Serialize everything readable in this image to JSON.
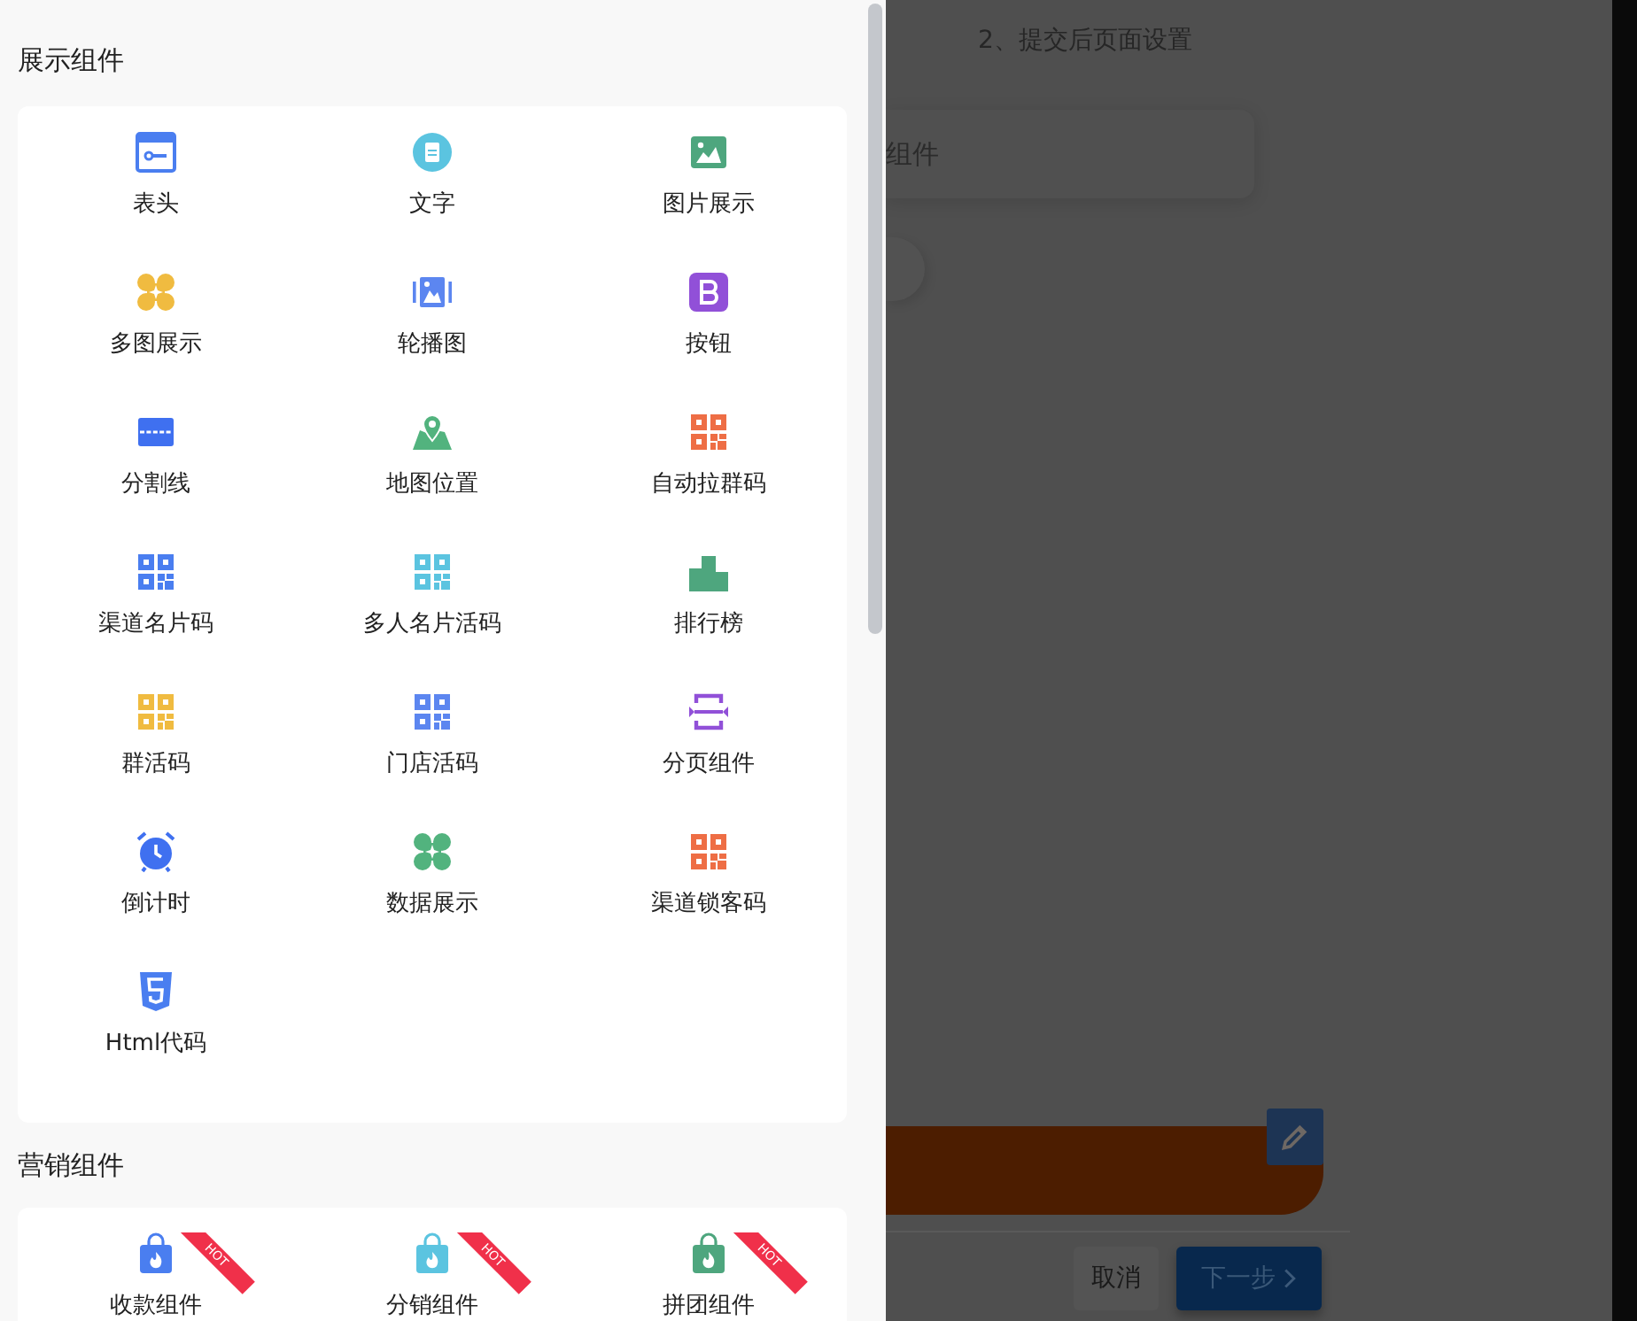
{
  "sections": [
    {
      "title": "展示组件",
      "items": [
        {
          "label": "表头",
          "kind": "header",
          "color": "#4a7ef0"
        },
        {
          "label": "文字",
          "kind": "text",
          "color": "#5bc4e0"
        },
        {
          "label": "图片展示",
          "kind": "image",
          "color": "#4ea67e"
        },
        {
          "label": "多图展示",
          "kind": "multi",
          "color": "#f0bb40"
        },
        {
          "label": "轮播图",
          "kind": "carousel",
          "color": "#5c86f0"
        },
        {
          "label": "按钮",
          "kind": "button",
          "color": "#9150d8"
        },
        {
          "label": "分割线",
          "kind": "divider",
          "color": "#3f70f0"
        },
        {
          "label": "地图位置",
          "kind": "map",
          "color": "#52b37e"
        },
        {
          "label": "自动拉群码",
          "kind": "qrcode",
          "color": "#ee6e45"
        },
        {
          "label": "渠道名片码",
          "kind": "qrcode",
          "color": "#4a7ef0"
        },
        {
          "label": "多人名片活码",
          "kind": "qrcode",
          "color": "#5bc4e0"
        },
        {
          "label": "排行榜",
          "kind": "ranking",
          "color": "#4ea67e"
        },
        {
          "label": "群活码",
          "kind": "qrcode",
          "color": "#f0bb40"
        },
        {
          "label": "门店活码",
          "kind": "qrcode",
          "color": "#5c86f0"
        },
        {
          "label": "分页组件",
          "kind": "pagination",
          "color": "#9150d8"
        },
        {
          "label": "倒计时",
          "kind": "clock",
          "color": "#3f70f0"
        },
        {
          "label": "数据展示",
          "kind": "multi",
          "color": "#52b37e"
        },
        {
          "label": "渠道锁客码",
          "kind": "qrcode",
          "color": "#ee6e45"
        },
        {
          "label": "Html代码",
          "kind": "html5",
          "color": "#4a7ef0"
        }
      ]
    },
    {
      "title": "营销组件",
      "items": [
        {
          "label": "收款组件",
          "kind": "bag",
          "color": "#4a7ef0",
          "badge": "HOT"
        },
        {
          "label": "分销组件",
          "kind": "bag",
          "color": "#5bc4e0",
          "badge": "HOT"
        },
        {
          "label": "拼团组件",
          "kind": "bag",
          "color": "#4ea67e",
          "badge": "HOT"
        }
      ]
    }
  ],
  "background": {
    "step_title": "2、提交后页面设置",
    "card_text": "组件",
    "buttons": [
      {
        "label": "取消",
        "kind": "default"
      },
      {
        "label": "下一步",
        "kind": "primary"
      }
    ]
  }
}
